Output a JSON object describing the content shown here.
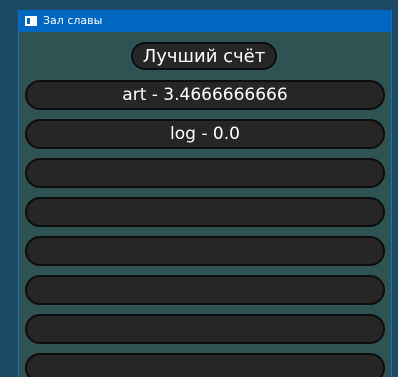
{
  "window": {
    "title": "Зал славы",
    "icon": "app-window-icon"
  },
  "header": {
    "label": "Лучший счёт"
  },
  "scores": [
    {
      "text": "art  -  3.4666666666"
    },
    {
      "text": "log  -  0.0"
    },
    {
      "text": ""
    },
    {
      "text": ""
    },
    {
      "text": ""
    },
    {
      "text": ""
    },
    {
      "text": ""
    },
    {
      "text": ""
    }
  ],
  "colors": {
    "titlebar": "#0067c0",
    "background": "#2f5252",
    "pill": "#262626",
    "pill_border": "#0d0d0d",
    "text": "#ffffff"
  }
}
